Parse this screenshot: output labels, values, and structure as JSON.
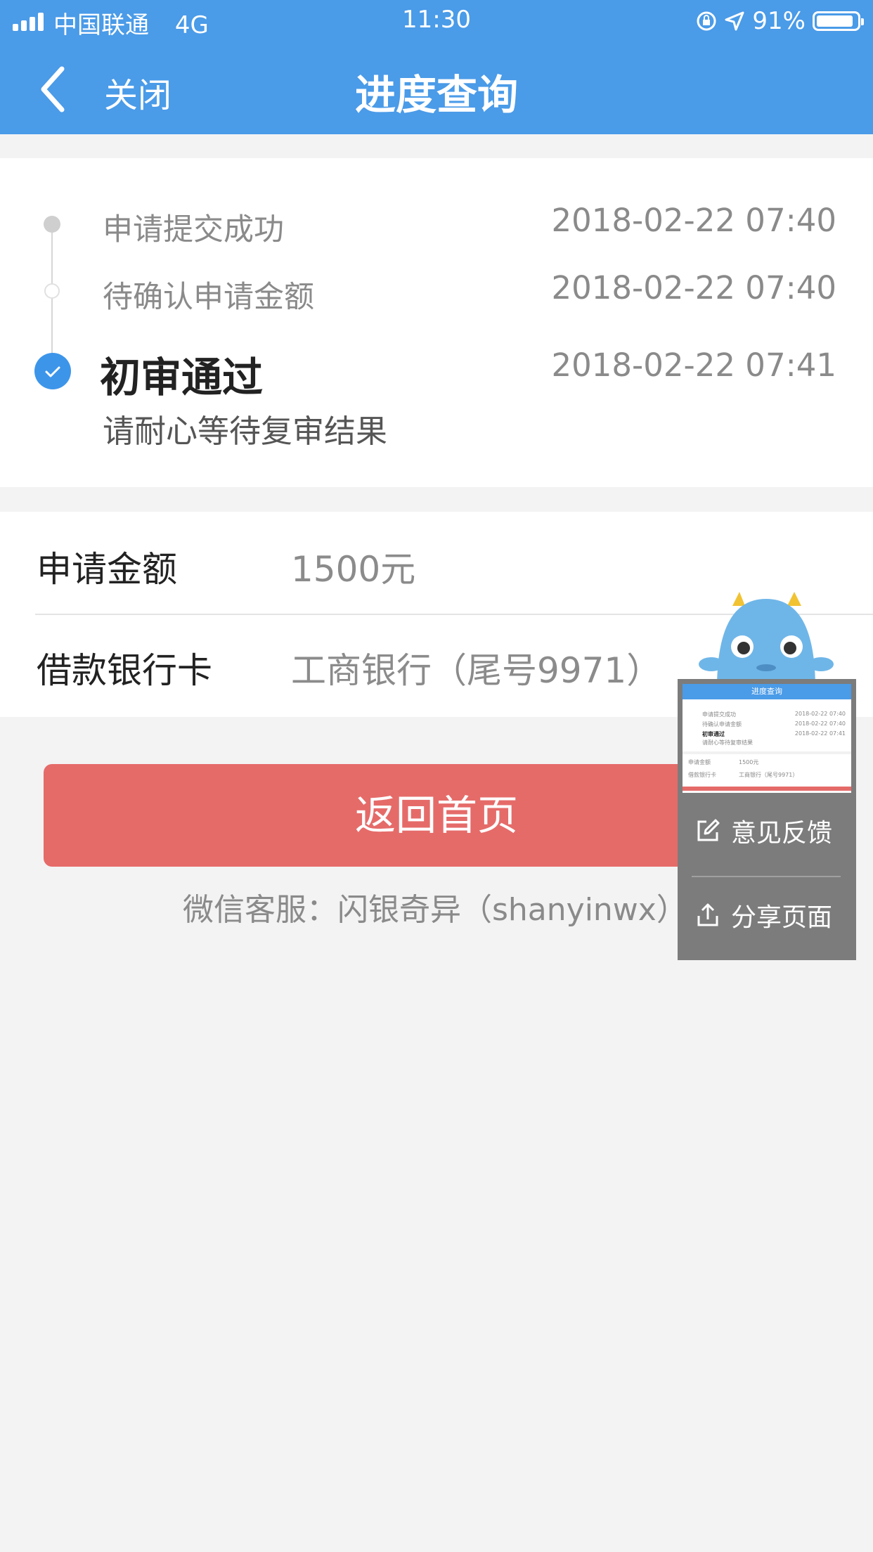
{
  "status_bar": {
    "carrier": "中国联通",
    "network": "4G",
    "time": "11:30",
    "battery": "91%",
    "battery_level": 0.91
  },
  "nav": {
    "close_label": "关闭",
    "title": "进度查询"
  },
  "progress": [
    {
      "label": "申请提交成功",
      "time": "2018-02-22 07:40"
    },
    {
      "label": "待确认申请金额",
      "time": "2018-02-22 07:40"
    },
    {
      "label": "初审通过",
      "time": "2018-02-22 07:41",
      "sub": "请耐心等待复审结果"
    }
  ],
  "info": [
    {
      "key": "申请金额",
      "value": "1500元"
    },
    {
      "key": "借款银行卡",
      "value": "工商银行（尾号9971）"
    }
  ],
  "home_button": "返回首页",
  "wechat_service": "微信客服：闪银奇异（shanyinwx）",
  "float_menu": {
    "feedback": "意见反馈",
    "share": "分享页面"
  },
  "colors": {
    "header": "#4a9be8",
    "primary_button": "#e56b69",
    "active_step": "#3d95ea"
  }
}
